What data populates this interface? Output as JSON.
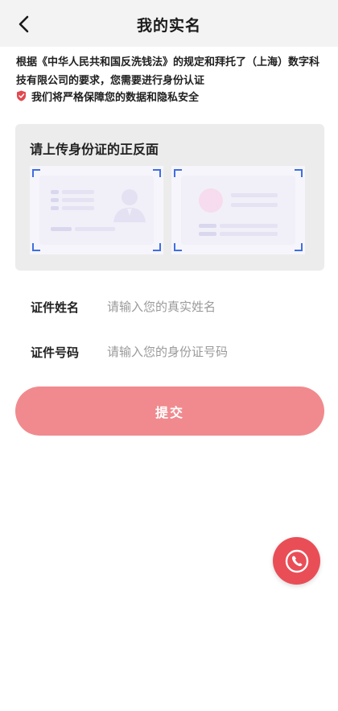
{
  "header": {
    "title": "我的实名",
    "back_icon": "chevron-left-icon"
  },
  "intro": {
    "notice": "根据《中华人民共和国反洗钱法》的规定和拜托了（上海）数字科技有限公司的要求，您需要进行身份认证",
    "privacy_text": "我们将严格保障您的数据和隐私安全",
    "privacy_icon": "shield-icon"
  },
  "upload": {
    "title": "请上传身份证的正反面",
    "front_icon": "id-card-front-icon",
    "back_icon": "id-card-back-icon"
  },
  "form": {
    "name_label": "证件姓名",
    "name_placeholder": "请输入您的真实姓名",
    "id_label": "证件号码",
    "id_placeholder": "请输入您的身份证号码"
  },
  "submit_label": "提交",
  "float_button_icon": "phone-icon",
  "colors": {
    "accent": "#f08a8e",
    "phone_button": "#e94e57",
    "corner_blue": "#3f6fe0",
    "header_bg": "#f3f3f3",
    "card_bg": "#ececec"
  }
}
